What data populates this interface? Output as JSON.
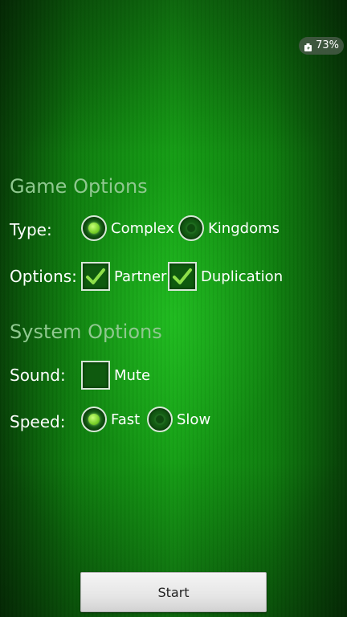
{
  "status_bar": {
    "battery_percent": "73%",
    "battery_icon": "battery-charging-icon"
  },
  "game_options": {
    "title": "Game Options",
    "type": {
      "label": "Type:",
      "options": [
        {
          "label": "Complex",
          "selected": true
        },
        {
          "label": "Kingdoms",
          "selected": false
        }
      ]
    },
    "options": {
      "label": "Options:",
      "items": [
        {
          "label": "Partner",
          "checked": true
        },
        {
          "label": "Duplication",
          "checked": true
        }
      ]
    }
  },
  "system_options": {
    "title": "System Options",
    "sound": {
      "label": "Sound:",
      "items": [
        {
          "label": "Mute",
          "checked": false
        }
      ]
    },
    "speed": {
      "label": "Speed:",
      "options": [
        {
          "label": "Fast",
          "selected": true
        },
        {
          "label": "Slow",
          "selected": false
        }
      ]
    }
  },
  "start_button": {
    "label": "Start"
  },
  "colors": {
    "background": "#15a015",
    "section_title": "#8fc88f",
    "radio_on": "#7ad22a",
    "check_mark": "#8ee04a"
  }
}
